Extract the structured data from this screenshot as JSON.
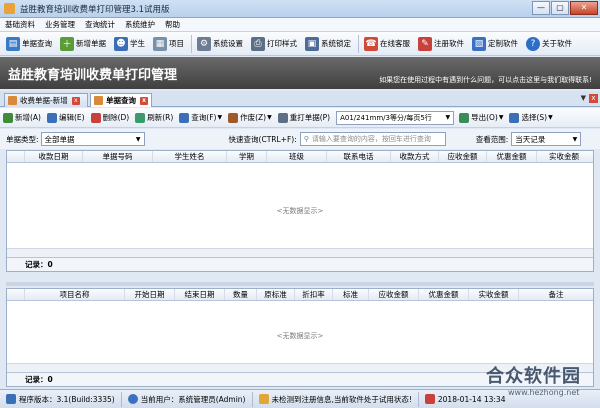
{
  "window": {
    "title": "益胜教育培训收费单打印管理3.1试用版",
    "controls": [
      "—",
      "▢",
      "✕"
    ]
  },
  "menu": [
    "基础资料",
    "业务管理",
    "查询统计",
    "系统维护",
    "帮助"
  ],
  "toolbar": [
    {
      "label": "单据查询",
      "icon": "receipt-search-icon",
      "color": "#3a7bc8"
    },
    {
      "label": "新增单据",
      "icon": "new-document-icon",
      "color": "#5a9c3a"
    },
    {
      "label": "学生",
      "icon": "student-icon",
      "color": "#3a6fb8"
    },
    {
      "label": "项目",
      "icon": "project-icon",
      "color": "#7a8fa8"
    },
    {
      "label": "系统设置",
      "icon": "gear-icon",
      "color": "#6d7c90"
    },
    {
      "label": "打印样式",
      "icon": "printer-icon",
      "color": "#5c6f86"
    },
    {
      "label": "系统锁定",
      "icon": "lock-icon",
      "color": "#4d6b96"
    },
    {
      "label": "在线客服",
      "icon": "customer-service-icon",
      "color": "#d04a3a"
    },
    {
      "label": "注册软件",
      "icon": "register-icon",
      "color": "#c8413a"
    },
    {
      "label": "定制软件",
      "icon": "custom-software-icon",
      "color": "#3a72c0"
    },
    {
      "label": "关于软件",
      "icon": "about-icon",
      "color": "#2e6ec4"
    }
  ],
  "banner": {
    "title": "益胜教育培训收费单打印管理",
    "note": "如果您在使用过程中有遇到什么问题，可以点击这里与我们取得联系!"
  },
  "doc_tabs": [
    {
      "label": "收费单据-新增",
      "active": false
    },
    {
      "label": "单据查询",
      "active": true
    }
  ],
  "actions": [
    {
      "label": "新增(A)",
      "icon": "add-icon",
      "color": "#3f8b3a"
    },
    {
      "label": "编辑(E)",
      "icon": "edit-icon",
      "color": "#3a6fb8"
    },
    {
      "label": "删除(D)",
      "icon": "delete-icon",
      "color": "#c8413a"
    },
    {
      "label": "刷新(R)",
      "icon": "refresh-icon",
      "color": "#3a9c6a"
    },
    {
      "label": "查询(F)",
      "icon": "query-icon",
      "color": "#3a6fb8"
    },
    {
      "label": "作废(Z)",
      "icon": "void-icon",
      "color": "#a05a2a"
    },
    {
      "label": "重打单据(P)",
      "icon": "reprint-icon",
      "color": "#5c6f86"
    }
  ],
  "paper_select": "A01/241mm/3等分/每页5行",
  "right_actions": [
    {
      "label": "导出(O)",
      "icon": "export-icon",
      "color": "#3a8b5a"
    },
    {
      "label": "选择(S)",
      "icon": "select-icon",
      "color": "#3a6fb8"
    }
  ],
  "filter": {
    "doc_type_label": "单据类型:",
    "doc_type_value": "全部单据",
    "quick_label": "快速查询(CTRL+F):",
    "quick_placeholder": "请输入要查询的内容，按回车进行查询",
    "range_label": "查看范围:",
    "range_value": "当天记录"
  },
  "main_grid": {
    "columns": [
      "收款日期",
      "单据号码",
      "学生姓名",
      "学期",
      "班级",
      "联系电话",
      "收款方式",
      "应收金额",
      "优惠金额",
      "实收金额"
    ],
    "empty": "<无数据显示>",
    "footer": "记录：0"
  },
  "detail_grid": {
    "columns": [
      "项目名称",
      "开始日期",
      "结束日期",
      "数量",
      "原标准",
      "折扣率",
      "标准",
      "应收金额",
      "优惠金额",
      "实收金额",
      "备注"
    ],
    "empty": "<无数据显示>",
    "footer": "记录：0"
  },
  "status": {
    "version": "程序版本：3.1(Build:3335)",
    "user": "当前用户：系统管理员(Admin)",
    "reg": "未检测到注册信息,当前软件处于试用状态!",
    "datetime": "2018-01-14 13:34"
  },
  "watermark": {
    "text": "合众软件园",
    "url": "www.hezhong.net"
  }
}
